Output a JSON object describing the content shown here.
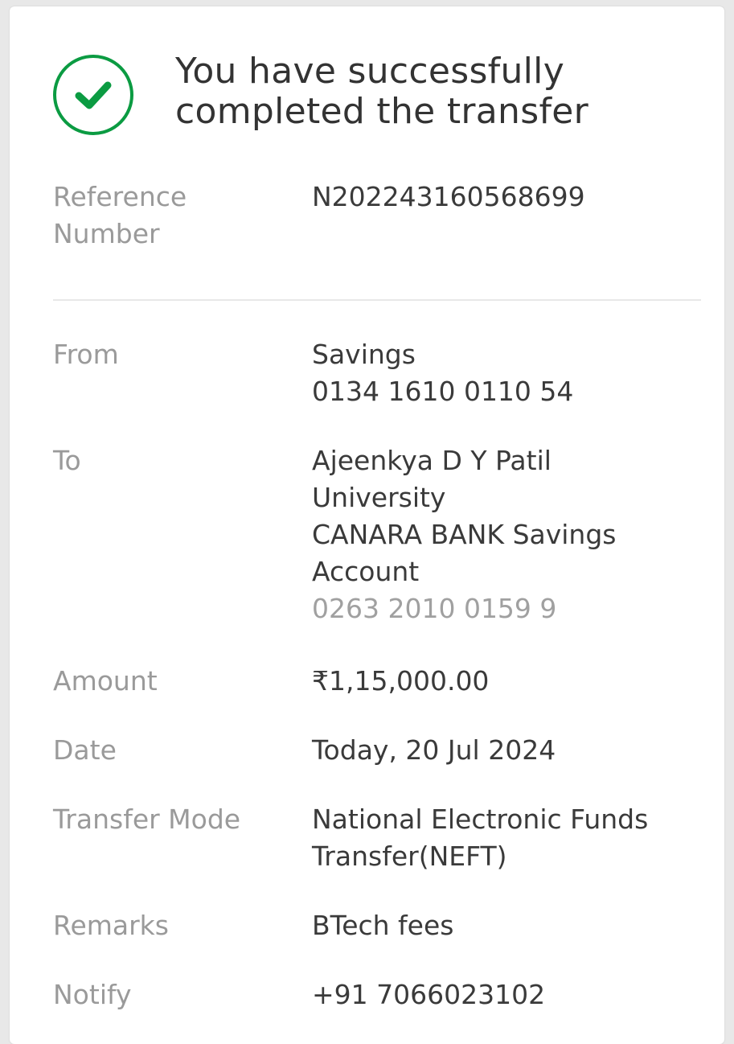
{
  "colors": {
    "success_green": "#0b9b42",
    "label_gray": "#9a9a9a",
    "value_dark": "#3a3a3a"
  },
  "header": {
    "icon": "check-circle-icon",
    "line1": "You have successfully",
    "line2": "completed the transfer"
  },
  "reference": {
    "label_line1": "Reference",
    "label_line2": "Number",
    "value": "N202243160568699"
  },
  "from": {
    "label": "From",
    "account_type": "Savings",
    "account_number": "0134 1610 0110 54"
  },
  "to": {
    "label": "To",
    "name_line1": "Ajeenkya D Y Patil",
    "name_line2": "University",
    "bank_line1": "CANARA BANK Savings",
    "bank_line2": "Account",
    "account_number": "0263 2010 0159 9"
  },
  "amount": {
    "label": "Amount",
    "value": "₹1,15,000.00"
  },
  "date": {
    "label": "Date",
    "value": "Today, 20 Jul 2024"
  },
  "transfer_mode": {
    "label": "Transfer Mode",
    "value_line1": "National Electronic Funds",
    "value_line2": "Transfer(NEFT)"
  },
  "remarks": {
    "label": "Remarks",
    "value": "BTech fees"
  },
  "notify": {
    "label": "Notify",
    "value": "+91 7066023102"
  }
}
